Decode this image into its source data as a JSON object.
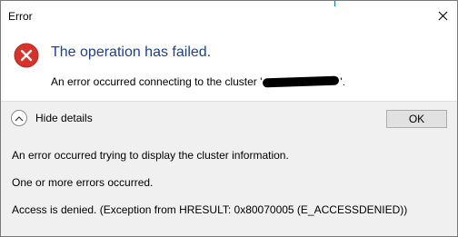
{
  "window": {
    "title": "Error"
  },
  "dialog": {
    "main_instruction": "The operation has failed.",
    "content_prefix": "An error occurred connecting to the cluster '",
    "content_suffix": "'."
  },
  "footer": {
    "toggle_label": "Hide details",
    "ok_label": "OK"
  },
  "details": {
    "lines": [
      "An error occurred trying to display the cluster information.",
      "One or more errors occurred.",
      "Access is denied. (Exception from HRESULT: 0x80070005 (E_ACCESSDENIED))"
    ]
  },
  "colors": {
    "instruction_text": "#1e3f9a",
    "error_icon": "#d8322b",
    "band_background": "#f0f0f0",
    "button_face": "#e1e1e1"
  },
  "icons": {
    "error": "error-icon",
    "close": "close-icon",
    "toggle": "chevron-up-icon"
  }
}
